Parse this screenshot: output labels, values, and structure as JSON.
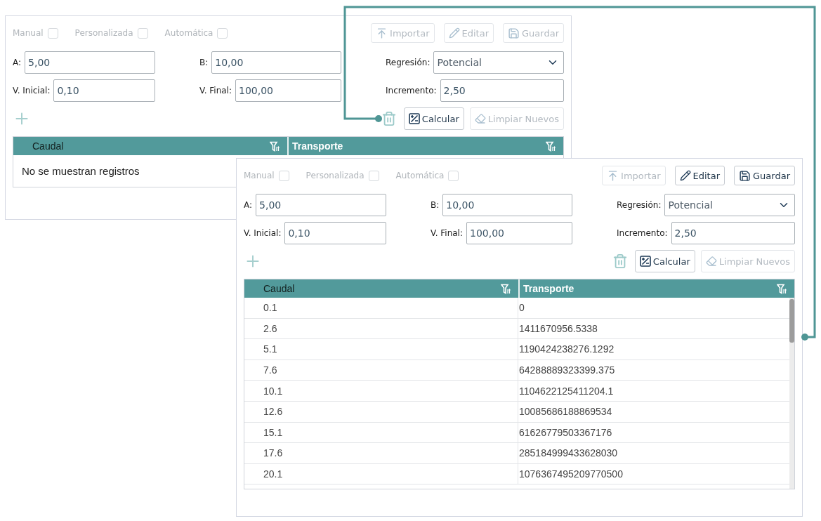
{
  "panels": [
    {
      "mode_options": [
        {
          "label": "Manual",
          "checked": false
        },
        {
          "label": "Personalizada",
          "checked": false
        },
        {
          "label": "Automática",
          "checked": false
        }
      ],
      "toolbar": [
        {
          "kind": "import",
          "label": "Importar",
          "disabled": true
        },
        {
          "kind": "edit",
          "label": "Editar",
          "disabled": true
        },
        {
          "kind": "save",
          "label": "Guardar",
          "disabled": true
        }
      ],
      "fields": [
        {
          "kind": "input",
          "label": "A:",
          "value": "5,00"
        },
        {
          "kind": "input",
          "label": "B:",
          "value": "10,00"
        },
        {
          "kind": "select",
          "label": "Regresión:",
          "value": "Potencial"
        },
        {
          "kind": "input",
          "label": "V. Inicial:",
          "value": "0,10"
        },
        {
          "kind": "input",
          "label": "V. Final:",
          "value": "100,00"
        },
        {
          "kind": "input",
          "label": "Incremento:",
          "value": "2,50"
        }
      ],
      "actions": [
        {
          "kind": "calculate",
          "label": "Calcular",
          "disabled": false
        },
        {
          "kind": "clear",
          "label": "Limpiar Nuevos",
          "disabled": true
        }
      ],
      "table": {
        "columns": [
          {
            "label": "Caudal",
            "selected": true
          },
          {
            "label": "Transporte",
            "selected": false
          }
        ],
        "empty_message": "No se muestran registros"
      }
    },
    {
      "mode_options": [
        {
          "label": "Manual",
          "checked": false
        },
        {
          "label": "Personalizada",
          "checked": false
        },
        {
          "label": "Automática",
          "checked": false
        }
      ],
      "toolbar": [
        {
          "kind": "import",
          "label": "Importar",
          "disabled": true
        },
        {
          "kind": "edit",
          "label": "Editar",
          "disabled": false
        },
        {
          "kind": "save",
          "label": "Guardar",
          "disabled": false
        }
      ],
      "fields": [
        {
          "kind": "input",
          "label": "A:",
          "value": "5,00"
        },
        {
          "kind": "input",
          "label": "B:",
          "value": "10,00"
        },
        {
          "kind": "select",
          "label": "Regresión:",
          "value": "Potencial"
        },
        {
          "kind": "input",
          "label": "V. Inicial:",
          "value": "0,10"
        },
        {
          "kind": "input",
          "label": "V. Final:",
          "value": "100,00"
        },
        {
          "kind": "input",
          "label": "Incremento:",
          "value": "2,50"
        }
      ],
      "actions": [
        {
          "kind": "calculate",
          "label": "Calcular",
          "disabled": false
        },
        {
          "kind": "clear",
          "label": "Limpiar Nuevos",
          "disabled": true
        }
      ],
      "table": {
        "columns": [
          {
            "label": "Caudal",
            "selected": true
          },
          {
            "label": "Transporte",
            "selected": false
          }
        ],
        "rows": [
          [
            "0.1",
            "0"
          ],
          [
            "2.6",
            "1411670956.5338"
          ],
          [
            "5.1",
            "1190424238276.1292"
          ],
          [
            "7.6",
            "64288889323399.375"
          ],
          [
            "10.1",
            "1104622125411204.1"
          ],
          [
            "12.6",
            "10085686188869534"
          ],
          [
            "15.1",
            "61626779503367176"
          ],
          [
            "17.6",
            "285184999433628030"
          ],
          [
            "20.1",
            "1076367495209770500"
          ]
        ]
      }
    }
  ]
}
